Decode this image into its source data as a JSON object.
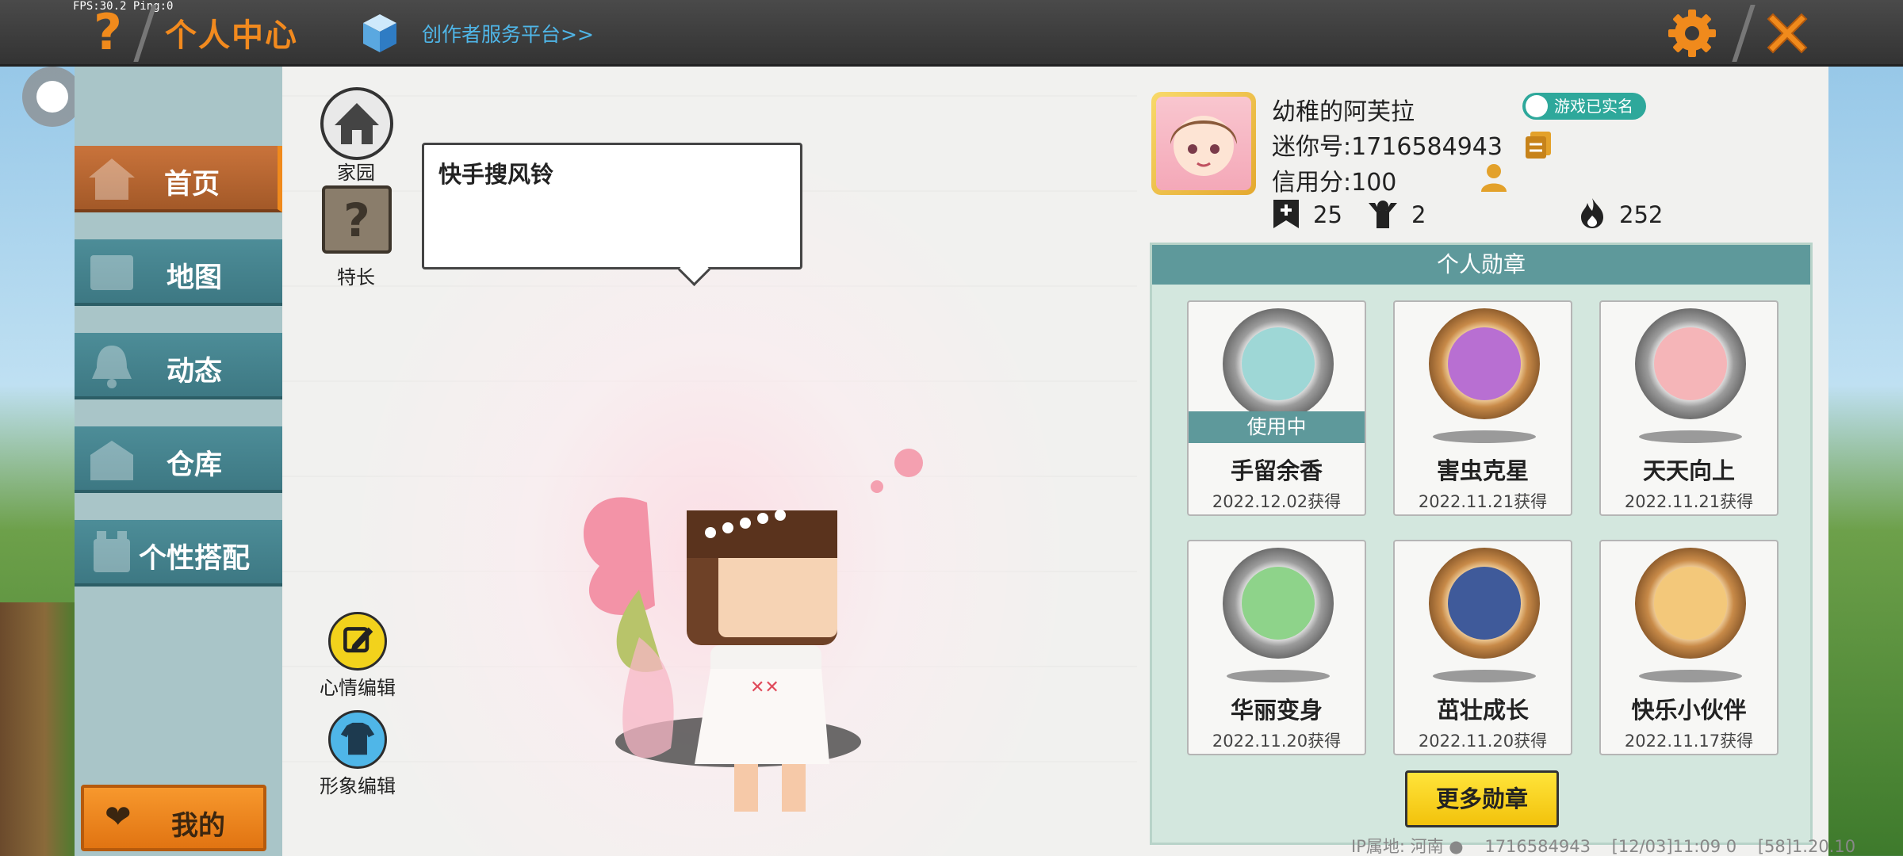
{
  "topbar": {
    "fps": "FPS:30.2  Ping:0",
    "help_glyph": "?",
    "title": "个人中心",
    "creator_link": "创作者服务平台>>",
    "accent": "#f08a1c"
  },
  "sidebar": {
    "items": [
      {
        "label": "首页",
        "icon": "house-icon",
        "active": true
      },
      {
        "label": "地图",
        "icon": "map-icon",
        "active": false
      },
      {
        "label": "动态",
        "icon": "bell-icon",
        "active": false
      },
      {
        "label": "仓库",
        "icon": "warehouse-icon",
        "active": false
      },
      {
        "label": "个性搭配",
        "icon": "outfit-icon",
        "active": false
      }
    ],
    "mine_label": "我的"
  },
  "stage": {
    "home_label": "家园",
    "talent_label": "特长",
    "talent_glyph": "?",
    "speech_text": "快手搜风铃",
    "mood_edit_label": "心情编辑",
    "avatar_edit_label": "形象编辑"
  },
  "profile": {
    "nickname": "幼稚的阿芙拉",
    "verified_label": "游戏已实名",
    "mini_id": "迷你号:1716584943",
    "credit": "信用分:100",
    "stats": {
      "bookmarks": "25",
      "fans": "2",
      "popularity": "252"
    }
  },
  "medals": {
    "header": "个人勋章",
    "in_use_label": "使用中",
    "items": [
      {
        "name": "手留余香",
        "date": "2022.12.02获得",
        "in_use": true,
        "frame": "silver",
        "icon": "frog-medal-icon"
      },
      {
        "name": "害虫克星",
        "date": "2022.11.21获得",
        "in_use": false,
        "frame": "bronze",
        "icon": "bug-medal-icon"
      },
      {
        "name": "天天向上",
        "date": "2022.11.21获得",
        "in_use": false,
        "frame": "silver",
        "icon": "calendar-medal-icon"
      },
      {
        "name": "华丽变身",
        "date": "2022.11.20获得",
        "in_use": false,
        "frame": "silver",
        "icon": "dino-medal-icon"
      },
      {
        "name": "茁壮成长",
        "date": "2022.11.20获得",
        "in_use": false,
        "frame": "bronze",
        "icon": "dragon-medal-icon"
      },
      {
        "name": "快乐小伙伴",
        "date": "2022.11.17获得",
        "in_use": false,
        "frame": "bronze",
        "icon": "friends-medal-icon"
      }
    ],
    "more_label": "更多勋章"
  },
  "footer": {
    "ip_location": "IP属地: 河南",
    "uid": "1716584943",
    "time": "[12/03]11:09 0",
    "version": "[58]1.20.10"
  }
}
